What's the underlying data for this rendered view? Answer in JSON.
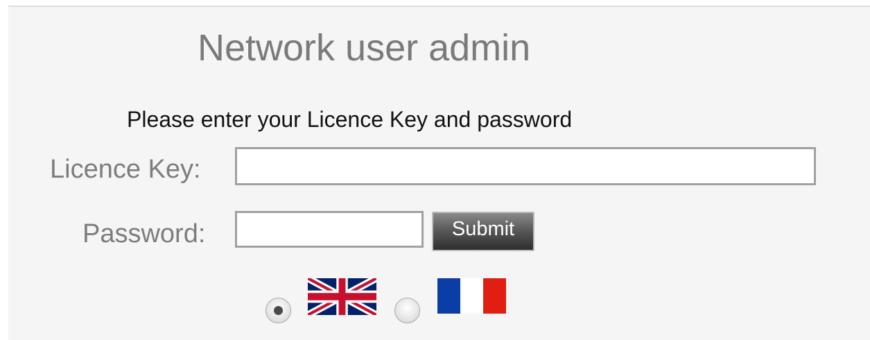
{
  "page": {
    "title": "Network user admin",
    "instruction": "Please enter your Licence Key and password"
  },
  "form": {
    "licence_key_label": "Licence Key:",
    "licence_key_value": "",
    "password_label": "Password:",
    "password_value": "",
    "submit_label": "Submit"
  },
  "language": {
    "selected": "en",
    "options": [
      {
        "code": "en",
        "flag_icon": "uk-flag-icon",
        "checked": true
      },
      {
        "code": "fr",
        "flag_icon": "france-flag-icon",
        "checked": false
      }
    ]
  },
  "colors": {
    "panel_background": "#f5f5f5",
    "title_text": "#7a7a7a",
    "label_text": "#7d7d7d",
    "instruction_text": "#111111",
    "input_border": "#a0a0a0",
    "button_dark": "#2e2e2e"
  }
}
